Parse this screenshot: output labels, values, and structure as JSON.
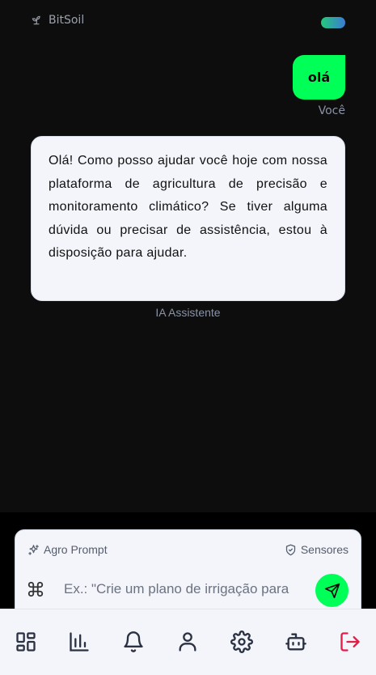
{
  "header": {
    "brand": "BitSoil",
    "brand_icon": "sprout-icon",
    "toggle_colors": [
      "#24c97a",
      "#3a7bd5"
    ]
  },
  "chat": {
    "messages": [
      {
        "role": "user",
        "text": "olá",
        "sender_label": "Você"
      },
      {
        "role": "assistant",
        "text": "Olá! Como posso ajudar você hoje com nossa plataforma de agricultura de precisão e monitoramento climático? Se tiver alguma dúvida ou precisar de assistência, estou à disposição para ajudar.",
        "sender_label": "IA Assistente"
      }
    ]
  },
  "composer": {
    "left_chip": "Agro Prompt",
    "left_chip_icon": "sparkles-icon",
    "right_chip": "Sensores",
    "right_chip_icon": "shield-check-icon",
    "placeholder": "Ex.: \"Crie um plano de irrigação para",
    "input_icon": "command-icon",
    "send_icon": "send-icon"
  },
  "nav": {
    "items": [
      {
        "icon": "dashboard-icon"
      },
      {
        "icon": "bar-chart-icon"
      },
      {
        "icon": "bell-icon"
      },
      {
        "icon": "user-icon"
      },
      {
        "icon": "settings-icon"
      },
      {
        "icon": "bot-icon"
      },
      {
        "icon": "logout-icon"
      }
    ]
  },
  "colors": {
    "accent": "#00ff57",
    "background": "#0d0d0e",
    "surface": "#f3f5fb",
    "muted_text": "#8a93a6",
    "logout": "#e11d48"
  }
}
